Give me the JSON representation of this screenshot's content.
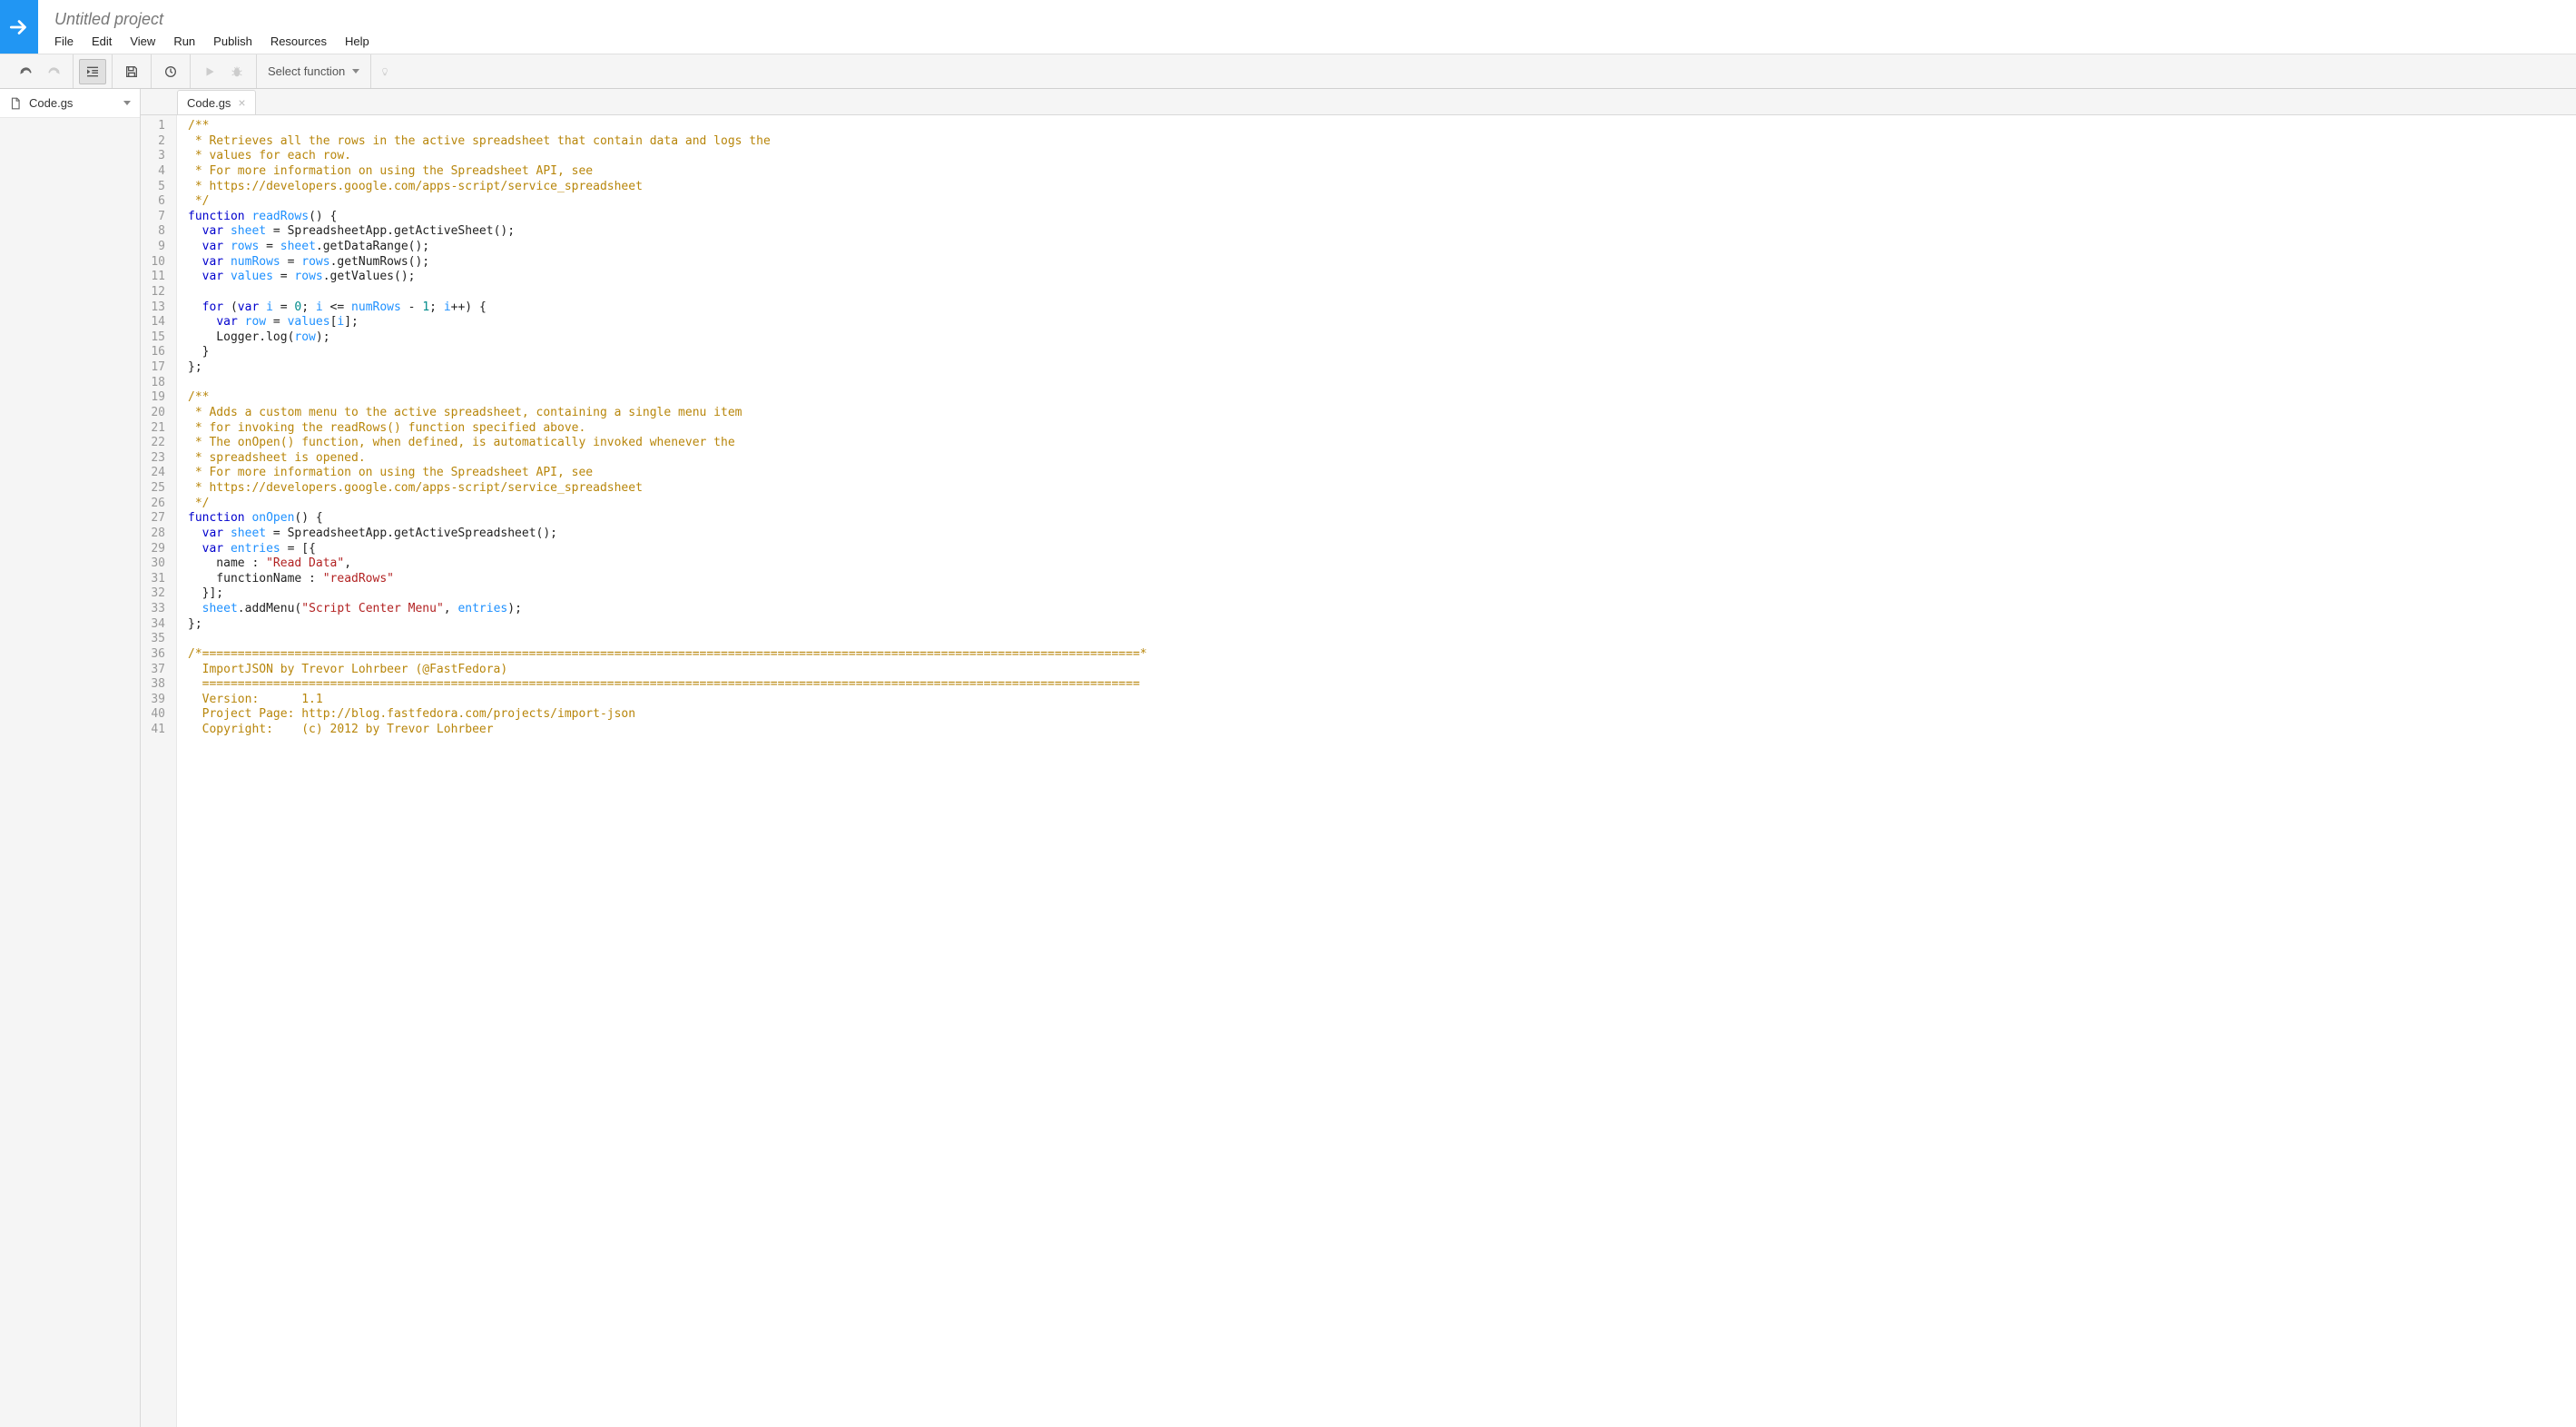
{
  "header": {
    "project_title": "Untitled project",
    "menu": [
      "File",
      "Edit",
      "View",
      "Run",
      "Publish",
      "Resources",
      "Help"
    ]
  },
  "toolbar": {
    "select_function_label": "Select function"
  },
  "sidebar": {
    "file_name": "Code.gs"
  },
  "tabs": [
    {
      "label": "Code.gs"
    }
  ],
  "code": {
    "lines": [
      [
        {
          "t": "comment",
          "s": "/**"
        }
      ],
      [
        {
          "t": "comment",
          "s": " * Retrieves all the rows in the active spreadsheet that contain data and logs the"
        }
      ],
      [
        {
          "t": "comment",
          "s": " * values for each row."
        }
      ],
      [
        {
          "t": "comment",
          "s": " * For more information on using the Spreadsheet API, see"
        }
      ],
      [
        {
          "t": "comment",
          "s": " * https://developers.google.com/apps-script/service_spreadsheet"
        }
      ],
      [
        {
          "t": "comment",
          "s": " */"
        }
      ],
      [
        {
          "t": "keyword",
          "s": "function"
        },
        {
          "t": "plain",
          "s": " "
        },
        {
          "t": "def",
          "s": "readRows"
        },
        {
          "t": "plain",
          "s": "() {"
        }
      ],
      [
        {
          "t": "plain",
          "s": "  "
        },
        {
          "t": "keyword",
          "s": "var"
        },
        {
          "t": "plain",
          "s": " "
        },
        {
          "t": "var",
          "s": "sheet"
        },
        {
          "t": "plain",
          "s": " = SpreadsheetApp.getActiveSheet();"
        }
      ],
      [
        {
          "t": "plain",
          "s": "  "
        },
        {
          "t": "keyword",
          "s": "var"
        },
        {
          "t": "plain",
          "s": " "
        },
        {
          "t": "var",
          "s": "rows"
        },
        {
          "t": "plain",
          "s": " = "
        },
        {
          "t": "var",
          "s": "sheet"
        },
        {
          "t": "plain",
          "s": ".getDataRange();"
        }
      ],
      [
        {
          "t": "plain",
          "s": "  "
        },
        {
          "t": "keyword",
          "s": "var"
        },
        {
          "t": "plain",
          "s": " "
        },
        {
          "t": "var",
          "s": "numRows"
        },
        {
          "t": "plain",
          "s": " = "
        },
        {
          "t": "var",
          "s": "rows"
        },
        {
          "t": "plain",
          "s": ".getNumRows();"
        }
      ],
      [
        {
          "t": "plain",
          "s": "  "
        },
        {
          "t": "keyword",
          "s": "var"
        },
        {
          "t": "plain",
          "s": " "
        },
        {
          "t": "var",
          "s": "values"
        },
        {
          "t": "plain",
          "s": " = "
        },
        {
          "t": "var",
          "s": "rows"
        },
        {
          "t": "plain",
          "s": ".getValues();"
        }
      ],
      [],
      [
        {
          "t": "plain",
          "s": "  "
        },
        {
          "t": "keyword",
          "s": "for"
        },
        {
          "t": "plain",
          "s": " ("
        },
        {
          "t": "keyword",
          "s": "var"
        },
        {
          "t": "plain",
          "s": " "
        },
        {
          "t": "var",
          "s": "i"
        },
        {
          "t": "plain",
          "s": " = "
        },
        {
          "t": "num",
          "s": "0"
        },
        {
          "t": "plain",
          "s": "; "
        },
        {
          "t": "var",
          "s": "i"
        },
        {
          "t": "plain",
          "s": " <= "
        },
        {
          "t": "var",
          "s": "numRows"
        },
        {
          "t": "plain",
          "s": " - "
        },
        {
          "t": "num",
          "s": "1"
        },
        {
          "t": "plain",
          "s": "; "
        },
        {
          "t": "var",
          "s": "i"
        },
        {
          "t": "plain",
          "s": "++) {"
        }
      ],
      [
        {
          "t": "plain",
          "s": "    "
        },
        {
          "t": "keyword",
          "s": "var"
        },
        {
          "t": "plain",
          "s": " "
        },
        {
          "t": "var",
          "s": "row"
        },
        {
          "t": "plain",
          "s": " = "
        },
        {
          "t": "var",
          "s": "values"
        },
        {
          "t": "plain",
          "s": "["
        },
        {
          "t": "var",
          "s": "i"
        },
        {
          "t": "plain",
          "s": "];"
        }
      ],
      [
        {
          "t": "plain",
          "s": "    Logger.log("
        },
        {
          "t": "var",
          "s": "row"
        },
        {
          "t": "plain",
          "s": ");"
        }
      ],
      [
        {
          "t": "plain",
          "s": "  }"
        }
      ],
      [
        {
          "t": "plain",
          "s": "};"
        }
      ],
      [],
      [
        {
          "t": "comment",
          "s": "/**"
        }
      ],
      [
        {
          "t": "comment",
          "s": " * Adds a custom menu to the active spreadsheet, containing a single menu item"
        }
      ],
      [
        {
          "t": "comment",
          "s": " * for invoking the readRows() function specified above."
        }
      ],
      [
        {
          "t": "comment",
          "s": " * The onOpen() function, when defined, is automatically invoked whenever the"
        }
      ],
      [
        {
          "t": "comment",
          "s": " * spreadsheet is opened."
        }
      ],
      [
        {
          "t": "comment",
          "s": " * For more information on using the Spreadsheet API, see"
        }
      ],
      [
        {
          "t": "comment",
          "s": " * https://developers.google.com/apps-script/service_spreadsheet"
        }
      ],
      [
        {
          "t": "comment",
          "s": " */"
        }
      ],
      [
        {
          "t": "keyword",
          "s": "function"
        },
        {
          "t": "plain",
          "s": " "
        },
        {
          "t": "def",
          "s": "onOpen"
        },
        {
          "t": "plain",
          "s": "() {"
        }
      ],
      [
        {
          "t": "plain",
          "s": "  "
        },
        {
          "t": "keyword",
          "s": "var"
        },
        {
          "t": "plain",
          "s": " "
        },
        {
          "t": "var",
          "s": "sheet"
        },
        {
          "t": "plain",
          "s": " = SpreadsheetApp.getActiveSpreadsheet();"
        }
      ],
      [
        {
          "t": "plain",
          "s": "  "
        },
        {
          "t": "keyword",
          "s": "var"
        },
        {
          "t": "plain",
          "s": " "
        },
        {
          "t": "var",
          "s": "entries"
        },
        {
          "t": "plain",
          "s": " = [{"
        }
      ],
      [
        {
          "t": "plain",
          "s": "    name : "
        },
        {
          "t": "str",
          "s": "\"Read Data\""
        },
        {
          "t": "plain",
          "s": ","
        }
      ],
      [
        {
          "t": "plain",
          "s": "    functionName : "
        },
        {
          "t": "str",
          "s": "\"readRows\""
        }
      ],
      [
        {
          "t": "plain",
          "s": "  }];"
        }
      ],
      [
        {
          "t": "plain",
          "s": "  "
        },
        {
          "t": "var",
          "s": "sheet"
        },
        {
          "t": "plain",
          "s": ".addMenu("
        },
        {
          "t": "str",
          "s": "\"Script Center Menu\""
        },
        {
          "t": "plain",
          "s": ", "
        },
        {
          "t": "var",
          "s": "entries"
        },
        {
          "t": "plain",
          "s": ");"
        }
      ],
      [
        {
          "t": "plain",
          "s": "};"
        }
      ],
      [],
      [
        {
          "t": "comment",
          "s": "/*====================================================================================================================================*"
        }
      ],
      [
        {
          "t": "comment",
          "s": "  ImportJSON by Trevor Lohrbeer (@FastFedora)"
        }
      ],
      [
        {
          "t": "comment",
          "s": "  ===================================================================================================================================="
        }
      ],
      [
        {
          "t": "comment",
          "s": "  Version:      1.1"
        }
      ],
      [
        {
          "t": "comment",
          "s": "  Project Page: http://blog.fastfedora.com/projects/import-json"
        }
      ],
      [
        {
          "t": "comment",
          "s": "  Copyright:    (c) 2012 by Trevor Lohrbeer"
        }
      ]
    ]
  }
}
